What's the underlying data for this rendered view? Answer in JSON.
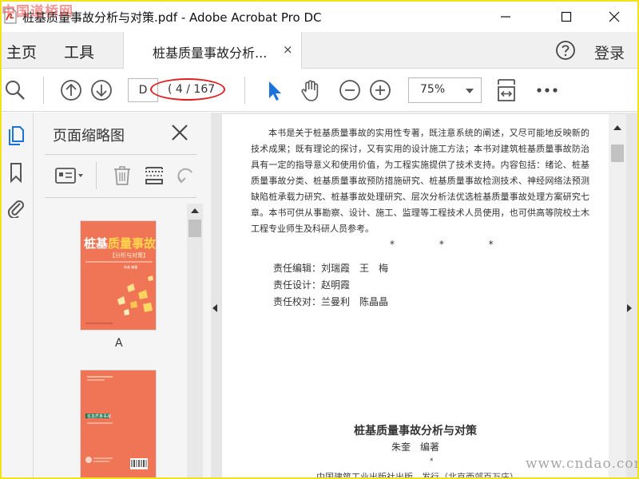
{
  "window": {
    "title": "桩基质量事故分析与对策.pdf - Adobe Acrobat Pro DC",
    "watermark_top": "中国道桥网",
    "watermark_bottom": "www.cndao.com"
  },
  "menubar": {
    "home": "主页",
    "tools": "工具",
    "tab_label": "桩基质量事故分析...",
    "tab_close": "×",
    "login": "登录"
  },
  "toolbar": {
    "page_input": "D",
    "page_count": "( 4 / 167",
    "zoom": "75%",
    "icons": [
      "search-icon",
      "prev-page-icon",
      "next-page-icon",
      "select-cursor-icon",
      "hand-icon",
      "zoom-out-icon",
      "zoom-in-icon",
      "fit-page-icon",
      "more-icon"
    ]
  },
  "thumbnails": {
    "title": "页面缩略图",
    "page_label": "A",
    "cover_title_white": "桩基",
    "cover_title_yellow": "质量事故",
    "cover_subtitle": "【分析与对策】",
    "cover_author": "朱奎 编著",
    "cover2_label": "桩基质量事故"
  },
  "document": {
    "paragraph": "本书是关于桩基质量事故的实用性专著，既注意系统的阐述，又尽可能地反映新的技术成果；既有理论的探讨，又有实用的设计施工方法；本书对建筑桩基质量事故防治具有一定的指导意义和使用价值，为工程实施提供了技术支持。内容包括：绪论、桩基质量事故分类、桩基质量事故预防措施研究、桩基质量事故检测技术、神经网络法预测缺陷桩承载力研究、桩基事故处理研究、层次分析法优选桩基质量事故处理方案研究七章。本书可供从事勘察、设计、施工、监理等工程技术人员使用，也可供高等院校土木工程专业师生及科研人员参考。",
    "stars": "* * *",
    "credits": [
      "责任编辑：刘瑞霞　王　梅",
      "责任设计：赵明霞",
      "责任校对：兰曼利　陈晶晶"
    ],
    "book_title": "桩基质量事故分析与对策",
    "author": "朱奎　编著",
    "small_star": "*",
    "publisher": "中国建筑工业出版社出版、发行（北京西郊百万庄）"
  },
  "colors": {
    "accent_blue": "#1a73d9",
    "cover_orange": "#f07456",
    "annotation_red": "#e02020",
    "frame_yellow": "#f2e21a"
  }
}
